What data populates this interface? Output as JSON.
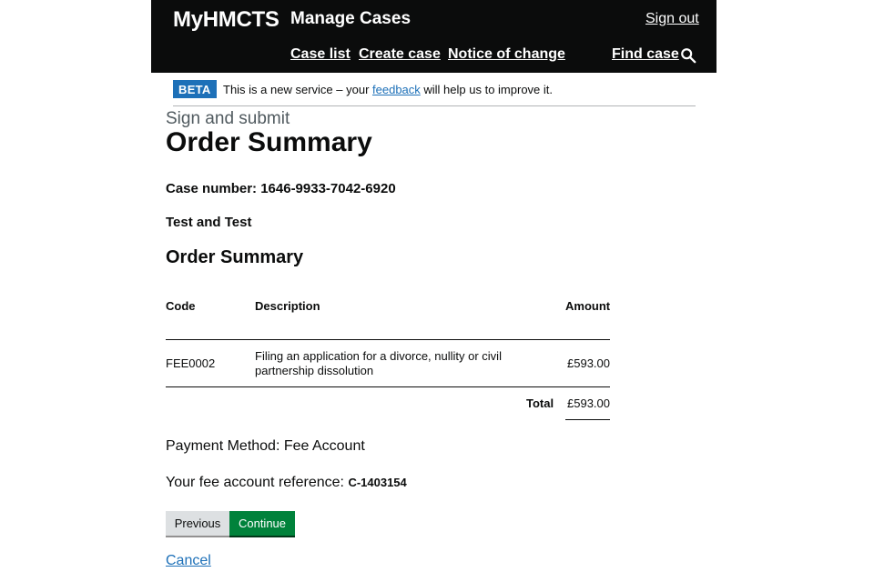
{
  "header": {
    "brand": "MyHMCTS",
    "service_name": "Manage Cases",
    "sign_out": "Sign out",
    "nav": {
      "case_list": "Case list",
      "create_case": "Create case",
      "notice_of_change": "Notice of change",
      "find_case": "Find case"
    }
  },
  "phase_banner": {
    "tag": "BETA",
    "text_before": "This is a new service – your ",
    "link": "feedback",
    "text_after": " will help us to improve it."
  },
  "page": {
    "caption": "Sign and submit",
    "title": "Order Summary",
    "case_number": "Case number: 1646-9933-7042-6920",
    "parties": "Test and Test",
    "section_heading": "Order Summary"
  },
  "order_table": {
    "headers": {
      "code": "Code",
      "description": "Description",
      "amount": "Amount"
    },
    "rows": [
      {
        "code": "FEE0002",
        "description_line1": "Filing an application for a divorce, nullity or civil",
        "description_line2": "partnership dissolution",
        "amount": "£593.00"
      }
    ],
    "total_label": "Total",
    "total_amount": "£593.00"
  },
  "payment": {
    "method": "Payment Method: Fee Account",
    "reference_label": "Your fee account reference: ",
    "reference_value": "C-1403154"
  },
  "actions": {
    "previous": "Previous",
    "continue": "Continue",
    "cancel": "Cancel"
  },
  "colors": {
    "header_bg": "#0b0c0c",
    "link": "#1d70b8",
    "beta_tag": "#1d70b8",
    "continue_button": "#00823b",
    "previous_button": "#dde0e2"
  },
  "icons": {
    "search": "search-icon"
  }
}
